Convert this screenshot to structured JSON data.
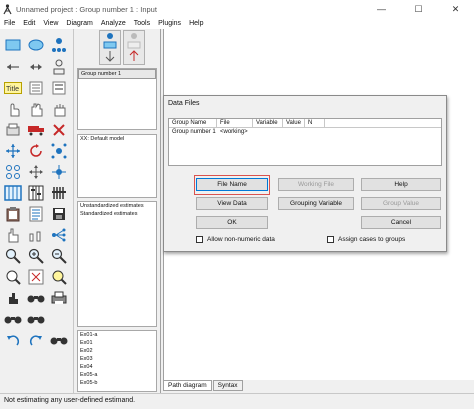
{
  "window": {
    "title": "Unnamed project : Group number 1 : Input",
    "minimize_glyph": "—",
    "maximize_glyph": "☐",
    "close_glyph": "✕"
  },
  "menu": [
    "File",
    "Edit",
    "View",
    "Diagram",
    "Analyze",
    "Tools",
    "Plugins",
    "Help"
  ],
  "panels": {
    "groups": [
      "Group number 1"
    ],
    "models": [
      "XX: Default model"
    ],
    "estimates": [
      "Unstandardized estimates",
      "Standardized estimates"
    ],
    "files": [
      "Ex01-a",
      "Ex01",
      "Ex02",
      "Ex03",
      "Ex04",
      "Ex05-a",
      "Ex05-b"
    ]
  },
  "canvas_tabs": [
    "Path diagram",
    "Syntax"
  ],
  "status": "Not estimating any user-defined estimand.",
  "dialog": {
    "title": "Data Files",
    "columns": [
      "Group Name",
      "File",
      "Variable",
      "Value",
      "N"
    ],
    "rows": [
      {
        "group": "Group number 1",
        "file": "<working>"
      }
    ],
    "buttons": {
      "file_name": "File Name",
      "working_file": "Working File",
      "help": "Help",
      "view_data": "View Data",
      "grouping_variable": "Grouping Variable",
      "group_value": "Group Value",
      "ok": "OK",
      "cancel": "Cancel"
    },
    "checkboxes": {
      "allow_nonnumeric": "Allow non-numeric data",
      "assign_cases": "Assign cases to groups"
    }
  },
  "colors": {
    "accent": "#0078d7",
    "highlight": "#d9534f",
    "icon_blue": "#1e73be",
    "icon_red": "#c62828"
  }
}
